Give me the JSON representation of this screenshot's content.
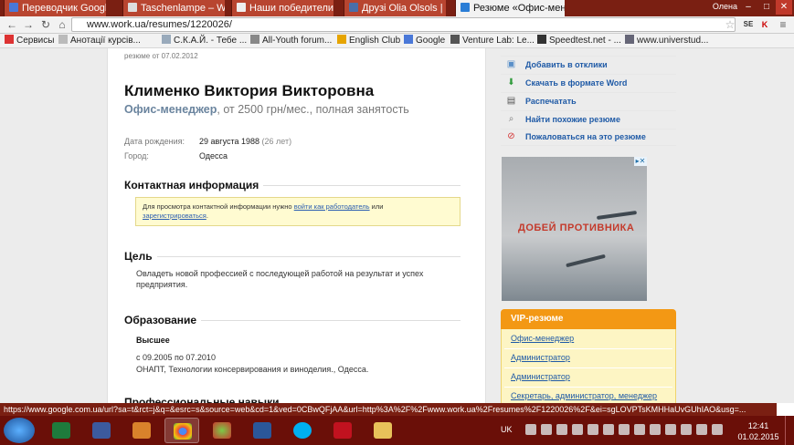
{
  "browser": {
    "tabs": [
      {
        "label": "Переводчик Google"
      },
      {
        "label": "Taschenlampe – Wik"
      },
      {
        "label": "Наши победители"
      },
      {
        "label": "Друзі Olia Olsols |"
      },
      {
        "label": "Резюме «Офис-менед"
      }
    ],
    "user": "Олена",
    "address": "www.work.ua/resumes/1220026/",
    "bookmarks": [
      {
        "label": "Сервисы"
      },
      {
        "label": "Анотації курсів..."
      },
      {
        "label": "С.К.А.Й. - Тебе ..."
      },
      {
        "label": "All-Youth forum..."
      },
      {
        "label": "English Club"
      },
      {
        "label": "Google"
      },
      {
        "label": "Venture Lab: Le..."
      },
      {
        "label": "Speedtest.net - ..."
      },
      {
        "label": "www.universtud..."
      }
    ],
    "status_url": "https://www.google.com.ua/url?sa=t&rct=j&q=&esrc=s&source=web&cd=1&ved=0CBwQFjAA&url=http%3A%2F%2Fwww.work.ua%2Fresumes%2F1220026%2F&ei=sgLOVPTsKMHHaUvGUhIAO&usg=..."
  },
  "resume": {
    "date": "резюме от 07.02.2012",
    "name": "Клименко Виктория Викторовна",
    "position": "Офис-менеджер",
    "terms": ", от 2500 грн/мес., полная занятость",
    "birth_label": "Дата рождения:",
    "birth_value": "29 августа 1988",
    "birth_age": "(26 лет)",
    "city_label": "Город:",
    "city_value": "Одесса",
    "contact_title": "Контактная информация",
    "contact_text": "Для просмотра контактной информации нужно ",
    "contact_link1": "войти как работодатель",
    "contact_or": " или",
    "contact_link2": "зарегистрироваться",
    "contact_end": ".",
    "goal_title": "Цель",
    "goal_text": "Овладеть новой профессией с последующей работой на результат и успех предприятия.",
    "edu_title": "Образование",
    "edu_level": "Высшее",
    "edu_period": "с 09.2005 по 07.2010",
    "edu_place": "ОНАПТ, Технологии консервирования и виноделия., Одесса.",
    "next_title": "Профессиональные навыки"
  },
  "sidebar": {
    "actions": [
      {
        "label": "Добавить в отклики",
        "icon": "add-response-icon"
      },
      {
        "label": "Скачать в формате Word",
        "icon": "download-icon"
      },
      {
        "label": "Распечатать",
        "icon": "printer-icon"
      },
      {
        "label": "Найти похожие резюме",
        "icon": "magnifier-icon"
      },
      {
        "label": "Пожаловаться на это резюме",
        "icon": "block-icon"
      }
    ],
    "ad_text": "ДОБЕЙ ПРОТИВНИКА",
    "vip_title": "VIP-резюме",
    "vip_items": [
      "Офис-менеджер",
      "Администратор",
      "Администратор",
      "Секретарь, администратор, менеджер"
    ]
  },
  "taskbar": {
    "lang": "UK",
    "time": "12:41",
    "date": "01.02.2015"
  },
  "colors": {
    "accent": "#f39814",
    "link": "#1f5aa6",
    "chrome": "#7a1f12"
  }
}
